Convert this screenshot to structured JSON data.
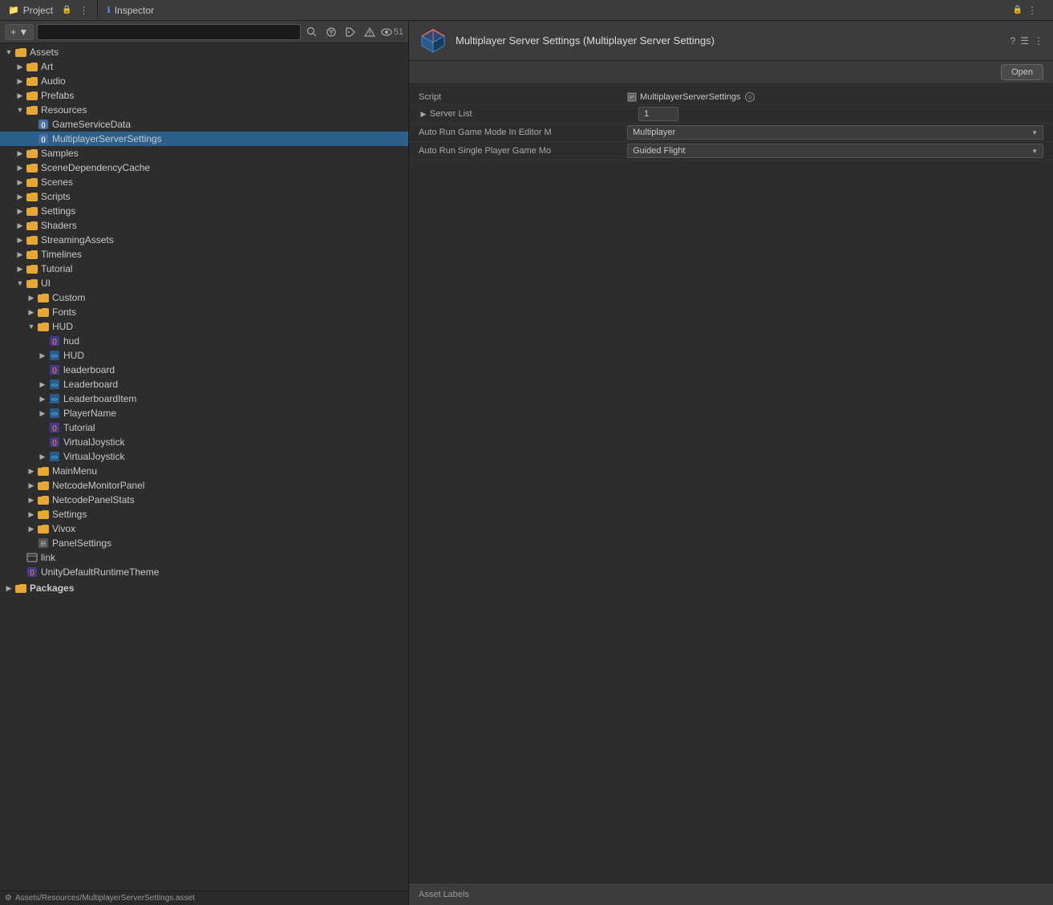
{
  "tabs": {
    "project": "Project",
    "inspector": "Inspector"
  },
  "toolbar": {
    "add_label": "+ ▼",
    "search_placeholder": "",
    "eye_count": "51"
  },
  "project_tree": {
    "assets_label": "Assets",
    "items": [
      {
        "id": "art",
        "label": "Art",
        "indent": 2,
        "type": "folder_collapsed",
        "arrow": "collapsed"
      },
      {
        "id": "audio",
        "label": "Audio",
        "indent": 2,
        "type": "folder_collapsed",
        "arrow": "collapsed"
      },
      {
        "id": "prefabs",
        "label": "Prefabs",
        "indent": 2,
        "type": "folder_collapsed",
        "arrow": "collapsed"
      },
      {
        "id": "resources",
        "label": "Resources",
        "indent": 2,
        "type": "folder_expanded",
        "arrow": "expanded"
      },
      {
        "id": "gameservicedata",
        "label": "GameServiceData",
        "indent": 3,
        "type": "scriptable",
        "arrow": "leaf"
      },
      {
        "id": "multiplayerserversettings",
        "label": "MultiplayerServerSettings",
        "indent": 3,
        "type": "scriptable_selected",
        "arrow": "leaf"
      },
      {
        "id": "samples",
        "label": "Samples",
        "indent": 2,
        "type": "folder_collapsed",
        "arrow": "collapsed"
      },
      {
        "id": "scenedependencycache",
        "label": "SceneDependencyCache",
        "indent": 2,
        "type": "folder_collapsed",
        "arrow": "collapsed"
      },
      {
        "id": "scenes",
        "label": "Scenes",
        "indent": 2,
        "type": "folder_collapsed",
        "arrow": "collapsed"
      },
      {
        "id": "scripts",
        "label": "Scripts",
        "indent": 2,
        "type": "folder_collapsed",
        "arrow": "collapsed"
      },
      {
        "id": "settings",
        "label": "Settings",
        "indent": 2,
        "type": "folder_collapsed",
        "arrow": "collapsed"
      },
      {
        "id": "shaders",
        "label": "Shaders",
        "indent": 2,
        "type": "folder_collapsed",
        "arrow": "collapsed"
      },
      {
        "id": "streamingassets",
        "label": "StreamingAssets",
        "indent": 2,
        "type": "folder_collapsed",
        "arrow": "collapsed"
      },
      {
        "id": "timelines",
        "label": "Timelines",
        "indent": 2,
        "type": "folder_collapsed",
        "arrow": "collapsed"
      },
      {
        "id": "tutorial",
        "label": "Tutorial",
        "indent": 2,
        "type": "folder_collapsed",
        "arrow": "collapsed"
      },
      {
        "id": "ui",
        "label": "UI",
        "indent": 2,
        "type": "folder_expanded",
        "arrow": "expanded"
      },
      {
        "id": "custom",
        "label": "Custom",
        "indent": 3,
        "type": "folder_collapsed",
        "arrow": "collapsed"
      },
      {
        "id": "fonts",
        "label": "Fonts",
        "indent": 3,
        "type": "folder_collapsed",
        "arrow": "collapsed"
      },
      {
        "id": "hud",
        "label": "HUD",
        "indent": 3,
        "type": "folder_expanded",
        "arrow": "expanded"
      },
      {
        "id": "hud_file",
        "label": "hud",
        "indent": 4,
        "type": "cs_file",
        "arrow": "leaf"
      },
      {
        "id": "hud_prefab",
        "label": "HUD",
        "indent": 4,
        "type": "prefab_file",
        "arrow": "collapsed"
      },
      {
        "id": "leaderboard_cs",
        "label": "leaderboard",
        "indent": 4,
        "type": "cs_file",
        "arrow": "leaf"
      },
      {
        "id": "leaderboard_prefab",
        "label": "Leaderboard",
        "indent": 4,
        "type": "prefab_file",
        "arrow": "collapsed"
      },
      {
        "id": "leaderboarditem_prefab",
        "label": "LeaderboardItem",
        "indent": 4,
        "type": "prefab_file",
        "arrow": "collapsed"
      },
      {
        "id": "playername_prefab",
        "label": "PlayerName",
        "indent": 4,
        "type": "prefab_file",
        "arrow": "collapsed"
      },
      {
        "id": "tutorial_cs",
        "label": "Tutorial",
        "indent": 4,
        "type": "cs_file",
        "arrow": "leaf"
      },
      {
        "id": "virtualjoystick_cs",
        "label": "VirtualJoystick",
        "indent": 4,
        "type": "cs_file",
        "arrow": "leaf"
      },
      {
        "id": "virtualjoystick_prefab",
        "label": "VirtualJoystick",
        "indent": 4,
        "type": "prefab_file",
        "arrow": "collapsed"
      },
      {
        "id": "mainmenu",
        "label": "MainMenu",
        "indent": 3,
        "type": "folder_collapsed",
        "arrow": "collapsed"
      },
      {
        "id": "netcodemonitorpanel",
        "label": "NetcodeMonitorPanel",
        "indent": 3,
        "type": "folder_collapsed",
        "arrow": "collapsed"
      },
      {
        "id": "netcodepanelstats",
        "label": "NetcodePanelStats",
        "indent": 3,
        "type": "folder_collapsed",
        "arrow": "collapsed"
      },
      {
        "id": "settings_ui",
        "label": "Settings",
        "indent": 3,
        "type": "folder_collapsed",
        "arrow": "collapsed"
      },
      {
        "id": "vivox",
        "label": "Vivox",
        "indent": 3,
        "type": "folder_collapsed",
        "arrow": "collapsed"
      },
      {
        "id": "panelsettings",
        "label": "PanelSettings",
        "indent": 3,
        "type": "panel_asset",
        "arrow": "leaf"
      },
      {
        "id": "link",
        "label": "link",
        "indent": 2,
        "type": "link_file",
        "arrow": "leaf"
      },
      {
        "id": "unitydefaultruntime",
        "label": "UnityDefaultRuntimeTheme",
        "indent": 2,
        "type": "cs_file",
        "arrow": "leaf"
      }
    ],
    "packages_label": "Packages"
  },
  "inspector": {
    "title": "Multiplayer Server Settings (Multiplayer Server Settings)",
    "open_label": "Open",
    "script_label": "Script",
    "script_value": "MultiplayerServerSettings",
    "server_list_label": "Server List",
    "server_list_count": "1",
    "auto_run_editor_label": "Auto Run Game Mode In Editor M",
    "auto_run_editor_value": "Multiplayer",
    "auto_run_single_label": "Auto Run Single Player Game Mo",
    "auto_run_single_value": "Guided Flight",
    "footer_label": "Asset Labels"
  },
  "status_bar": {
    "path": "Assets/Resources/MultiplayerServerSettings.asset"
  },
  "icons": {
    "lock": "🔒",
    "menu": "⋮",
    "search": "🔍",
    "filter": "☰",
    "label_tag": "🏷",
    "info": "ℹ",
    "eye": "👁",
    "question": "?",
    "help": "?"
  }
}
